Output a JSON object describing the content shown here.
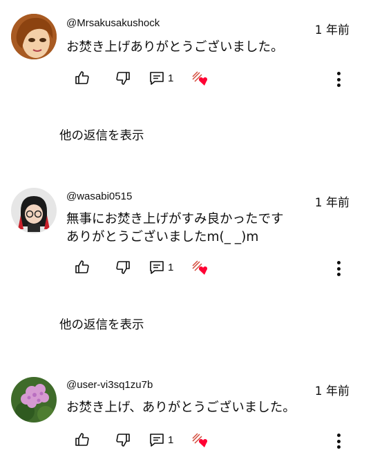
{
  "comments": [
    {
      "handle": "@Mrsakusakushock",
      "time": "1 年前",
      "text": "お焚き上げありがとうございました。",
      "reply_count": "1",
      "show_replies": "他の返信を表示"
    },
    {
      "handle": "@wasabi0515",
      "time": "1 年前",
      "text": "無事にお焚き上げがすみ良かったです\n ありがとうございましたm(_ _)m",
      "reply_count": "1",
      "show_replies": "他の返信を表示"
    },
    {
      "handle": "@user-vi3sq1zu7b",
      "time": "1 年前",
      "text": "お焚き上げ、ありがとうございました。",
      "reply_count": "1"
    }
  ],
  "icons": {
    "like": "thumbs-up-icon",
    "dislike": "thumbs-down-icon",
    "reply": "comment-reply-icon",
    "creator_heart": "creator-heart-icon",
    "more": "more-vertical-icon"
  },
  "colors": {
    "text": "#0f0f0f",
    "heart": "#ff0033"
  }
}
